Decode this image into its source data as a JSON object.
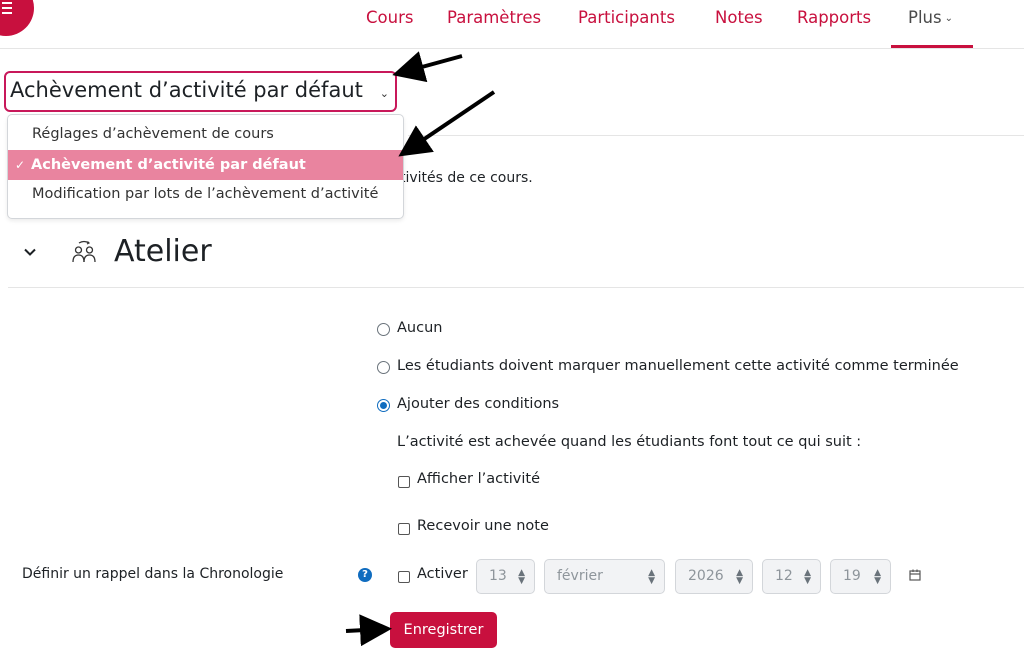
{
  "nav": {
    "items": [
      "Cours",
      "Paramètres",
      "Participants",
      "Notes",
      "Rapports"
    ],
    "more_label": "Plus",
    "menu_icon": "hamburger-icon"
  },
  "page_select": {
    "current": "Achèvement d’activité par défaut",
    "options": [
      "Réglages d’achèvement de cours",
      "Achèvement d’activité par défaut",
      "Modification par lots de l’achèvement d’activité"
    ],
    "selected_index": 1
  },
  "description_fragment": "tivités de ce cours.",
  "section": {
    "title": "Atelier",
    "icon": "workshop-icon"
  },
  "completion": {
    "options": [
      "Aucun",
      "Les étudiants doivent marquer manuellement cette activité comme terminée",
      "Ajouter des conditions"
    ],
    "selected_index": 2,
    "conditions_intro": "L’activité est achevée quand les étudiants font tout ce qui suit :",
    "view_label": "Afficher l’activité",
    "grade_label": "Recevoir une note"
  },
  "reminder": {
    "label": "Définir un rappel dans la Chronologie",
    "enable_label": "Activer",
    "day": "13",
    "month": "février",
    "year": "2026",
    "hour": "12",
    "minute": "19"
  },
  "save_label": "Enregistrer",
  "colors": {
    "brand": "#c8103e",
    "selected_item": "#e9849f",
    "radio_accent": "#0f6cbf"
  }
}
